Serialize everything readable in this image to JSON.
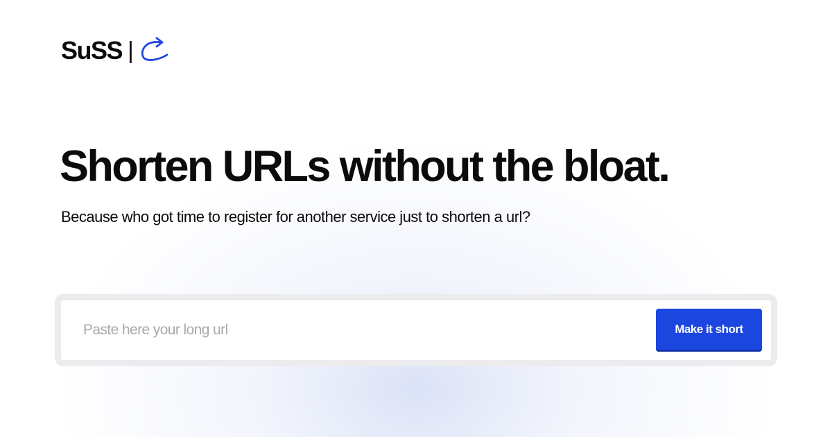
{
  "brand": {
    "name": "SuSS",
    "divider": "|",
    "icon": "curved-arrow-icon",
    "accent_color": "#1c46e0"
  },
  "hero": {
    "headline": "Shorten URLs without the bloat.",
    "subheadline": "Because who got time to register for another service just to shorten a url?"
  },
  "shorten_form": {
    "input_value": "",
    "input_placeholder": "Paste here your long url",
    "submit_label": "Make it short",
    "button_color": "#1c46e0"
  }
}
